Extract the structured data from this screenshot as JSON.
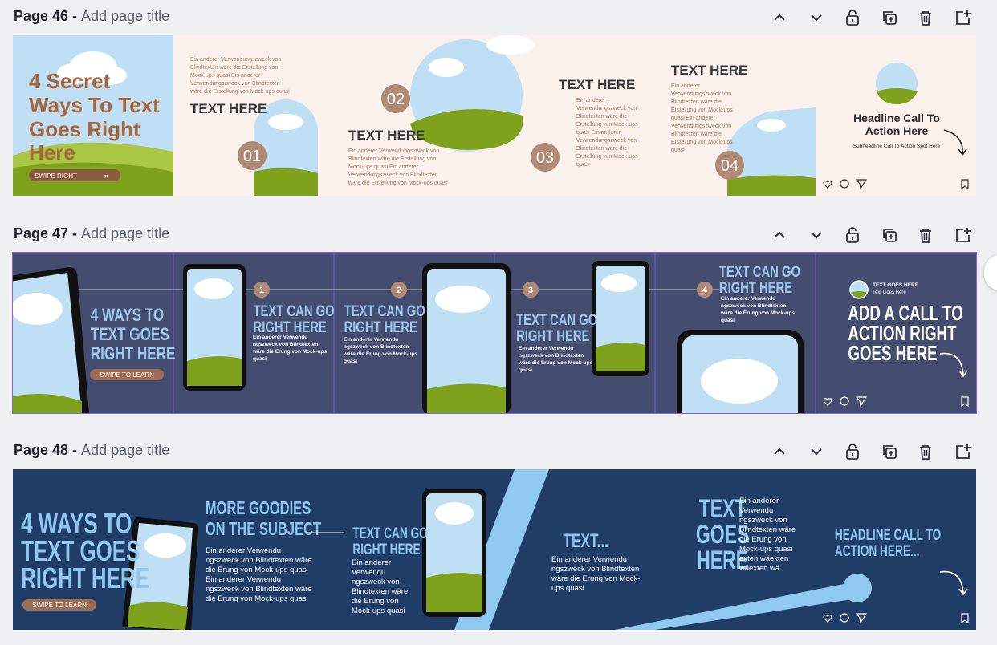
{
  "pages": [
    {
      "number_label": "Page 46 - ",
      "title_placeholder": "Add page title",
      "slide": {
        "cover_title_lines": [
          "4 Secret",
          "Ways To Text",
          "Goes Right",
          "Here"
        ],
        "swipe_label": "SWIPE RIGHT",
        "step_numbers": [
          "01",
          "02",
          "03",
          "04"
        ],
        "heading": "TEXT HERE",
        "body_lines": [
          "Ein anderer Verwendungszweck von",
          "Blindtexten wäre die Erstellung von",
          "Mock-ups quasi Ein anderer",
          "Verwendungszweck von Blindtexten",
          "wäre die Erstellung von Mock-ups quasi"
        ],
        "body_lines_narrow": [
          "Ein anderer",
          "Verwendungszweck von",
          "Blindtexten wäre die",
          "Erstellung von Mock-ups",
          "quasi Ein anderer",
          "Verwendungszweck von",
          "Blindtexten wäre die",
          "Erstellung von Mock-ups",
          "quasi"
        ],
        "cta_lines": [
          "Headline Call To",
          "Action Here"
        ],
        "cta_sub": "Subheadline Call To Action Spot Here"
      }
    },
    {
      "number_label": "Page 47 - ",
      "title_placeholder": "Add page title",
      "slide": {
        "cover_title_lines": [
          "4 WAYS TO",
          "TEXT GOES",
          "RIGHT HERE"
        ],
        "swipe_label": "SWIPE TO LEARN",
        "step_numbers": [
          "1",
          "2",
          "3",
          "4"
        ],
        "heading_lines": [
          "TEXT CAN GO",
          "RIGHT HERE"
        ],
        "body_lines": [
          "Ein anderer Verwendu",
          "ngszweck von Blindtexten",
          "wäre die Erung von Mock-ups",
          "quasi"
        ],
        "profile_name": "TEXT GOES HERE",
        "profile_handle": "Text Goes Here",
        "cta_lines": [
          "ADD A CALL TO",
          "ACTION RIGHT",
          "GOES HERE"
        ]
      }
    },
    {
      "number_label": "Page 48 - ",
      "title_placeholder": "Add page title",
      "slide": {
        "cover_title_lines": [
          "4 WAYS TO",
          "TEXT GOES",
          "RIGHT HERE"
        ],
        "swipe_label": "SWIPE TO LEARN",
        "goodies_lines": [
          "MORE GOODIES",
          "ON THE SUBJECT"
        ],
        "goodies_body": [
          "Ein anderer Verwendu",
          "ngszweck von Blindtexten wäre",
          "die Erung von Mock-ups quasi",
          "Ein anderer Verwendu",
          "ngszweck von Blindtexten wäre",
          "die Erung von Mock-ups quasi"
        ],
        "can_go_lines": [
          "TEXT CAN GO",
          "RIGHT HERE"
        ],
        "can_go_body": [
          "Ein anderer",
          "Verwendu",
          "ngszweck von",
          "Blindtexten wäre",
          "die Erung von",
          "Mock-ups quasi"
        ],
        "text_dots": "TEXT...",
        "text_dots_body": [
          "Ein anderer Verwendu",
          "ngszweck von Blindtexten",
          "wäre die Erung von Mock-",
          "ups quasi"
        ],
        "goes_lines": [
          "TEXT",
          "GOES",
          "HERE"
        ],
        "goes_body": [
          "Ein anderer",
          "Verwendu",
          "ngszweck von",
          "Blindtexten wäre",
          "die Erung von",
          "Mock-ups quasi",
          "exten wäexten",
          "wäexten wä"
        ],
        "cta_lines": [
          "HEADLINE CALL TO",
          "ACTION HERE..."
        ]
      }
    }
  ],
  "icons": [
    "chevron-up-icon",
    "chevron-down-icon",
    "lock-icon",
    "duplicate-icon",
    "trash-icon",
    "add-page-icon",
    "heart-icon",
    "comment-icon",
    "send-icon",
    "bookmark-icon"
  ],
  "colors": {
    "cream": "#fbf1ec",
    "tan": "#b08a74",
    "brown": "#a9653b",
    "slate": "#444c6f",
    "navy": "#203d68",
    "light_blue": "#8fc9f0",
    "grass": "#7fa21c",
    "sky": "#bfe0f4"
  }
}
